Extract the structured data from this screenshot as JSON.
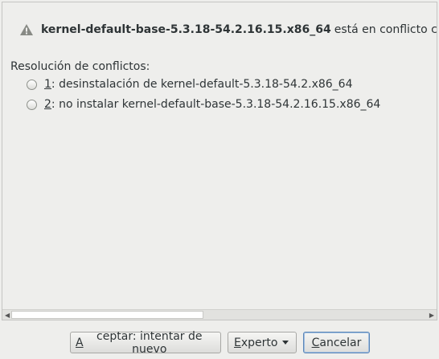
{
  "header": {
    "package": "kernel-default-base-5.3.18-54.2.16.15.x86_64",
    "message_rest": "está en conflicto con kernel"
  },
  "resolution_label": "Resolución de conflictos:",
  "options": [
    {
      "number": "1",
      "suffix": ": desinstalación de kernel-default-5.3.18-54.2.x86_64"
    },
    {
      "number": "2",
      "suffix": ": no instalar kernel-default-base-5.3.18-54.2.16.15.x86_64"
    }
  ],
  "buttons": {
    "accept_mnemonic": "A",
    "accept_rest": "ceptar: intentar de nuevo",
    "expert_mnemonic": "E",
    "expert_rest": "xperto",
    "cancel_mnemonic": "C",
    "cancel_rest": "ancelar"
  }
}
